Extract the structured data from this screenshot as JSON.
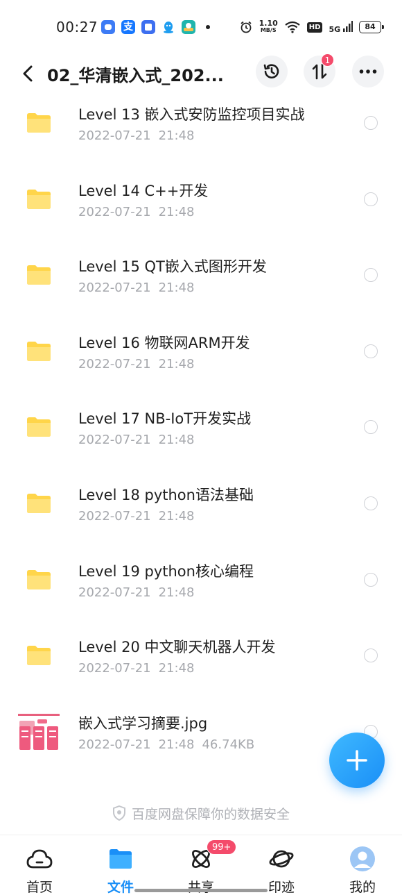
{
  "status_bar": {
    "time": "00:27",
    "net_speed": "1.10",
    "net_unit": "MB/S",
    "hd": "HD",
    "signal": "5G",
    "battery": "84",
    "app_icon_alipay": "支"
  },
  "header": {
    "title": "02_华清嵌入式_202...",
    "transfer_badge": "1"
  },
  "colors": {
    "accent": "#1a8ff7",
    "folder": "#ffd54a",
    "badge": "#f44b6b",
    "meta_text": "#a6a8ad"
  },
  "files": [
    {
      "name": "Level 13 嵌入式安防监控项目实战",
      "date": "2022-07-21",
      "time": "21:48",
      "size": "",
      "type": "folder"
    },
    {
      "name": "Level 14 C++开发",
      "date": "2022-07-21",
      "time": "21:48",
      "size": "",
      "type": "folder"
    },
    {
      "name": "Level 15 QT嵌入式图形开发",
      "date": "2022-07-21",
      "time": "21:48",
      "size": "",
      "type": "folder"
    },
    {
      "name": "Level 16 物联网ARM开发",
      "date": "2022-07-21",
      "time": "21:48",
      "size": "",
      "type": "folder"
    },
    {
      "name": "Level 17 NB-IoT开发实战",
      "date": "2022-07-21",
      "time": "21:48",
      "size": "",
      "type": "folder"
    },
    {
      "name": "Level 18 python语法基础",
      "date": "2022-07-21",
      "time": "21:48",
      "size": "",
      "type": "folder"
    },
    {
      "name": "Level 19 python核心编程",
      "date": "2022-07-21",
      "time": "21:48",
      "size": "",
      "type": "folder"
    },
    {
      "name": "Level 20 中文聊天机器人开发",
      "date": "2022-07-21",
      "time": "21:48",
      "size": "",
      "type": "folder"
    },
    {
      "name": "嵌入式学习摘要.jpg",
      "date": "2022-07-21",
      "time": "21:48",
      "size": "46.74KB",
      "type": "image"
    }
  ],
  "security_note": "百度网盘保障你的数据安全",
  "tabs": [
    {
      "label": "首页",
      "icon": "cloud-icon"
    },
    {
      "label": "文件",
      "icon": "folder-icon",
      "active": true
    },
    {
      "label": "共享",
      "icon": "atom-icon",
      "badge": "99+"
    },
    {
      "label": "印迹",
      "icon": "planet-icon"
    },
    {
      "label": "我的",
      "icon": "avatar-icon"
    }
  ]
}
